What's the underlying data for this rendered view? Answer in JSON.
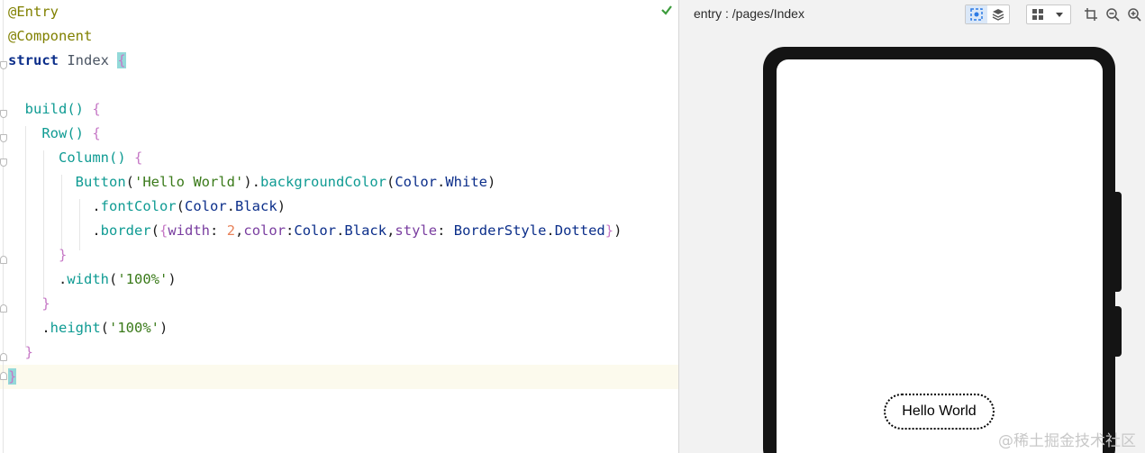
{
  "editor": {
    "lines": [
      {
        "tokens": [
          {
            "c": "ann",
            "t": "@Entry"
          }
        ]
      },
      {
        "tokens": [
          {
            "c": "ann",
            "t": "@Component"
          }
        ]
      },
      {
        "tokens": [
          {
            "c": "kw",
            "t": "struct"
          },
          {
            "c": "plain",
            "t": " "
          },
          {
            "c": "cls",
            "t": "Index"
          },
          {
            "c": "plain",
            "t": " "
          },
          {
            "c": "pn brace-hl",
            "t": "{"
          }
        ]
      },
      {
        "tokens": []
      },
      {
        "tokens": [
          {
            "c": "plain",
            "t": "  "
          },
          {
            "c": "fn",
            "t": "build"
          },
          {
            "c": "fn",
            "t": "()"
          },
          {
            "c": "plain",
            "t": " "
          },
          {
            "c": "pn",
            "t": "{"
          }
        ]
      },
      {
        "tokens": [
          {
            "c": "plain",
            "t": "    "
          },
          {
            "c": "fn",
            "t": "Row"
          },
          {
            "c": "fn",
            "t": "()"
          },
          {
            "c": "plain",
            "t": " "
          },
          {
            "c": "pn",
            "t": "{"
          }
        ]
      },
      {
        "tokens": [
          {
            "c": "plain",
            "t": "      "
          },
          {
            "c": "fn",
            "t": "Column"
          },
          {
            "c": "fn",
            "t": "()"
          },
          {
            "c": "plain",
            "t": " "
          },
          {
            "c": "pn",
            "t": "{"
          }
        ]
      },
      {
        "tokens": [
          {
            "c": "plain",
            "t": "        "
          },
          {
            "c": "fn",
            "t": "Button"
          },
          {
            "c": "plain",
            "t": "("
          },
          {
            "c": "str",
            "t": "'Hello World'"
          },
          {
            "c": "plain",
            "t": ")."
          },
          {
            "c": "fn",
            "t": "backgroundColor"
          },
          {
            "c": "plain",
            "t": "("
          },
          {
            "c": "ident",
            "t": "Color"
          },
          {
            "c": "plain",
            "t": "."
          },
          {
            "c": "ident",
            "t": "White"
          },
          {
            "c": "plain",
            "t": ")"
          }
        ]
      },
      {
        "tokens": [
          {
            "c": "plain",
            "t": "          ."
          },
          {
            "c": "fn",
            "t": "fontColor"
          },
          {
            "c": "plain",
            "t": "("
          },
          {
            "c": "ident",
            "t": "Color"
          },
          {
            "c": "plain",
            "t": "."
          },
          {
            "c": "ident",
            "t": "Black"
          },
          {
            "c": "plain",
            "t": ")"
          }
        ]
      },
      {
        "tokens": [
          {
            "c": "plain",
            "t": "          ."
          },
          {
            "c": "fn",
            "t": "border"
          },
          {
            "c": "plain",
            "t": "("
          },
          {
            "c": "pn",
            "t": "{"
          },
          {
            "c": "prop",
            "t": "width"
          },
          {
            "c": "plain",
            "t": ": "
          },
          {
            "c": "num",
            "t": "2"
          },
          {
            "c": "plain",
            "t": ","
          },
          {
            "c": "prop",
            "t": "color"
          },
          {
            "c": "plain",
            "t": ":"
          },
          {
            "c": "ident",
            "t": "Color"
          },
          {
            "c": "plain",
            "t": "."
          },
          {
            "c": "ident",
            "t": "Black"
          },
          {
            "c": "plain",
            "t": ","
          },
          {
            "c": "prop",
            "t": "style"
          },
          {
            "c": "plain",
            "t": ": "
          },
          {
            "c": "ident",
            "t": "BorderStyle"
          },
          {
            "c": "plain",
            "t": "."
          },
          {
            "c": "ident",
            "t": "Dotted"
          },
          {
            "c": "pn",
            "t": "}"
          },
          {
            "c": "plain",
            "t": ")"
          }
        ]
      },
      {
        "tokens": [
          {
            "c": "plain",
            "t": "      "
          },
          {
            "c": "pn",
            "t": "}"
          }
        ]
      },
      {
        "tokens": [
          {
            "c": "plain",
            "t": "      ."
          },
          {
            "c": "fn",
            "t": "width"
          },
          {
            "c": "plain",
            "t": "("
          },
          {
            "c": "str",
            "t": "'100%'"
          },
          {
            "c": "plain",
            "t": ")"
          }
        ]
      },
      {
        "tokens": [
          {
            "c": "plain",
            "t": "    "
          },
          {
            "c": "pn",
            "t": "}"
          }
        ]
      },
      {
        "tokens": [
          {
            "c": "plain",
            "t": "    ."
          },
          {
            "c": "fn",
            "t": "height"
          },
          {
            "c": "plain",
            "t": "("
          },
          {
            "c": "str",
            "t": "'100%'"
          },
          {
            "c": "plain",
            "t": ")"
          }
        ]
      },
      {
        "tokens": [
          {
            "c": "plain",
            "t": "  "
          },
          {
            "c": "pn",
            "t": "}"
          }
        ]
      },
      {
        "tokens": [
          {
            "c": "pn brace-hl",
            "t": "}"
          }
        ]
      }
    ]
  },
  "previewer": {
    "path": "entry : /pages/Index",
    "icons": [
      "inspector-icon",
      "layers-icon",
      "grid-icon",
      "dropdown-icon",
      "crop-icon",
      "zoom-out-icon",
      "zoom-in-icon"
    ]
  },
  "device": {
    "button_label": "Hello World"
  },
  "watermark": "@稀土掘金技术社区",
  "colors": {
    "annotation": "#808000",
    "keyword": "#0b2e8a",
    "function": "#0f9b93",
    "string": "#3a7a1a",
    "number": "#e8825a",
    "brace_highlight": "#93d9d9"
  }
}
